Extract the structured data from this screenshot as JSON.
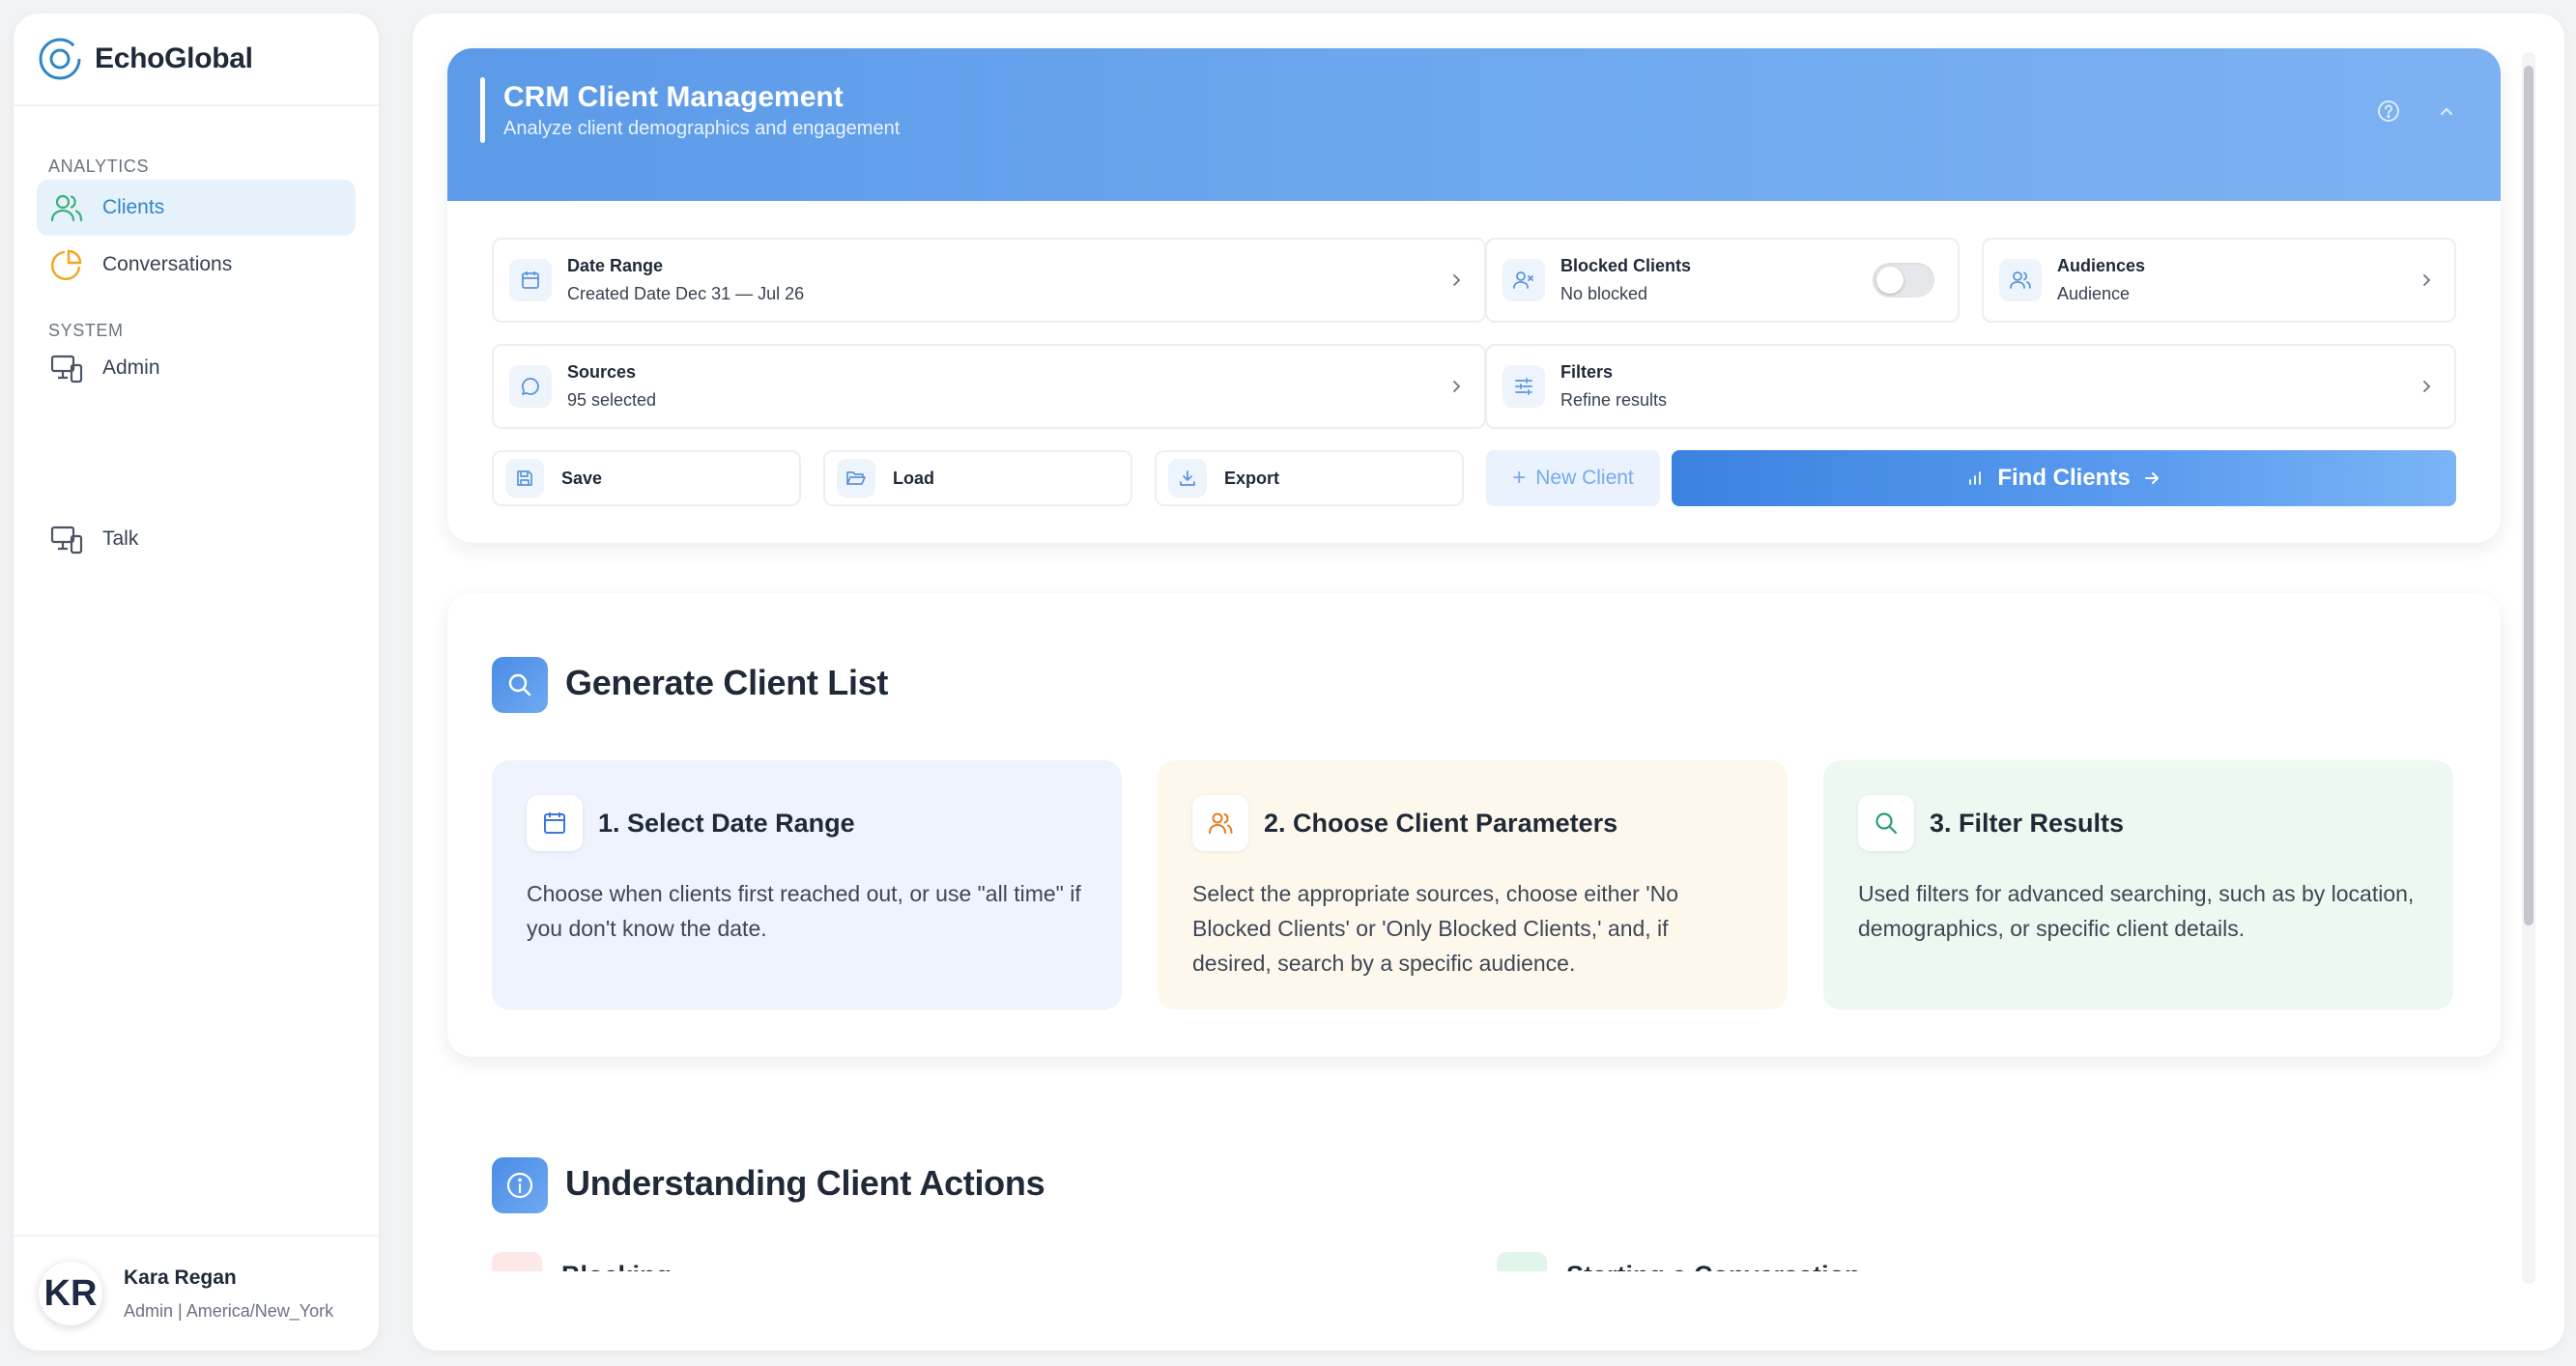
{
  "brand": {
    "name": "EchoGlobal"
  },
  "sidebar": {
    "sections": [
      {
        "label": "ANALYTICS"
      },
      {
        "label": "SYSTEM"
      }
    ],
    "items": [
      {
        "label": "Clients"
      },
      {
        "label": "Conversations"
      },
      {
        "label": "Admin"
      },
      {
        "label": "Talk"
      }
    ]
  },
  "user": {
    "initials": "KR",
    "name": "Kara Regan",
    "role": "Admin | America/New_York"
  },
  "header": {
    "title": "CRM Client Management",
    "subtitle": "Analyze client demographics and engagement"
  },
  "filters": {
    "date_range": {
      "label": "Date Range",
      "value": "Created Date Dec 31 — Jul 26"
    },
    "blocked": {
      "label": "Blocked Clients",
      "value": "No blocked",
      "enabled": false
    },
    "audiences": {
      "label": "Audiences",
      "value": "Audience"
    },
    "sources": {
      "label": "Sources",
      "value": "95 selected"
    },
    "refine": {
      "label": "Filters",
      "value": "Refine results"
    }
  },
  "actions": {
    "save": "Save",
    "load": "Load",
    "export": "Export",
    "new_client": "New Client",
    "find_clients": "Find Clients"
  },
  "generate": {
    "title": "Generate Client List",
    "steps": [
      {
        "title": "1. Select Date Range",
        "desc": "Choose when clients first reached out, or use \"all time\" if you don't know the date."
      },
      {
        "title": "2. Choose Client Parameters",
        "desc": "Select the appropriate sources, choose either 'No Blocked Clients' or 'Only Blocked Clients,' and, if desired, search by a specific audience."
      },
      {
        "title": "3. Filter Results",
        "desc": "Used filters for advanced searching, such as by location, demographics, or specific client details."
      }
    ]
  },
  "understanding": {
    "title": "Understanding Client Actions",
    "items": [
      {
        "title": "Blocking"
      },
      {
        "title": "Starting a Conversation"
      }
    ]
  },
  "colors": {
    "accent": "#4a8ce6",
    "active_nav_bg": "#e6f2fb",
    "active_nav_text": "#2f86c5",
    "step1_bg": "#eef3fd",
    "step2_bg": "#fef8ec",
    "step3_bg": "#edf8f1"
  }
}
